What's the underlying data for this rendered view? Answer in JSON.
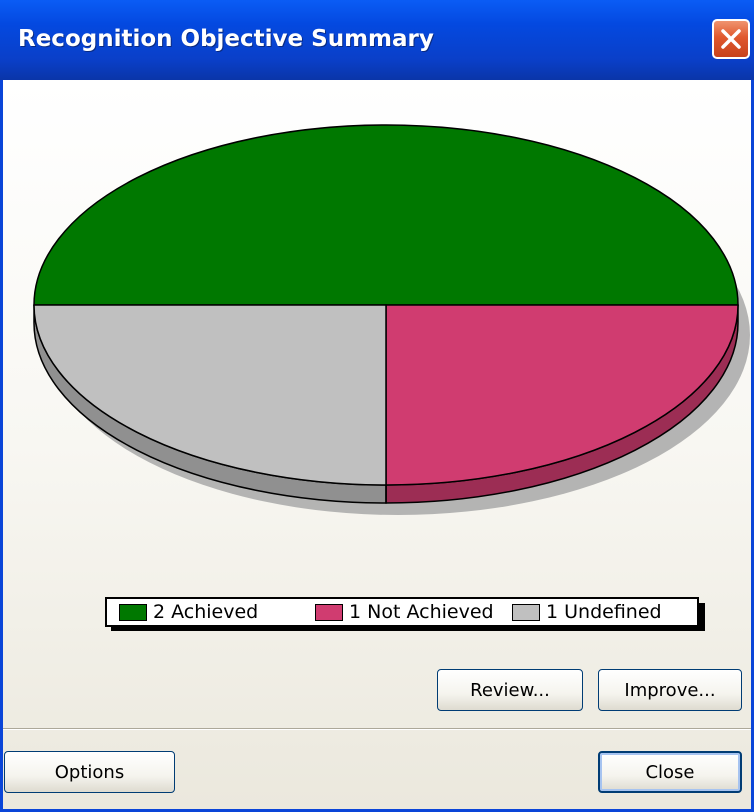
{
  "window": {
    "title": "Recognition Objective Summary"
  },
  "chart_data": {
    "type": "pie",
    "style": "3d",
    "title": "",
    "slices": [
      {
        "label": "2 Achieved",
        "value": 2,
        "color": "#007800"
      },
      {
        "label": "1 Not Achieved",
        "value": 1,
        "color": "#d03c70"
      },
      {
        "label": "1 Undefined",
        "value": 1,
        "color": "#c0c0c0"
      }
    ],
    "legend_placement": "bottom"
  },
  "legend": {
    "items": [
      {
        "label": "2 Achieved",
        "color": "#007800"
      },
      {
        "label": "1 Not Achieved",
        "color": "#d03c70"
      },
      {
        "label": "1 Undefined",
        "color": "#c0c0c0"
      }
    ]
  },
  "buttons": {
    "review": "Review...",
    "improve": "Improve...",
    "options": "Options",
    "close": "Close"
  },
  "icons": {
    "close": "close-icon"
  }
}
